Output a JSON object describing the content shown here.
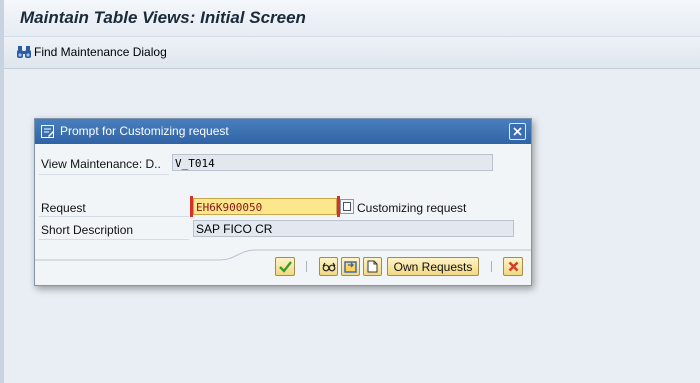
{
  "window": {
    "title": "Maintain Table Views: Initial Screen"
  },
  "toolbar": {
    "find_label": "Find Maintenance Dialog",
    "find_icon": "binoculars-icon"
  },
  "dialog": {
    "title": "Prompt for Customizing request",
    "view_maintenance_label": "View Maintenance: D..",
    "view_maintenance_value": "V_T014",
    "request_label": "Request",
    "request_value": "EH6K900050",
    "request_type_text": "Customizing request",
    "short_description_label": "Short Description",
    "short_description_value": "SAP FICO CR",
    "buttons": {
      "confirm_icon": "checkmark-icon",
      "glasses_icon": "glasses-icon",
      "switch_icon": "switch-icon",
      "create_icon": "new-document-icon",
      "own_requests_label": "Own Requests",
      "cancel_icon": "cancel-x-icon"
    }
  },
  "colors": {
    "header_blue": "#2f63a6",
    "request_field_bg": "#fde78d",
    "request_text": "#8a1414",
    "button_gold": "#f1d884",
    "cancel_red": "#d2402a",
    "confirm_green": "#3d9a2c"
  }
}
